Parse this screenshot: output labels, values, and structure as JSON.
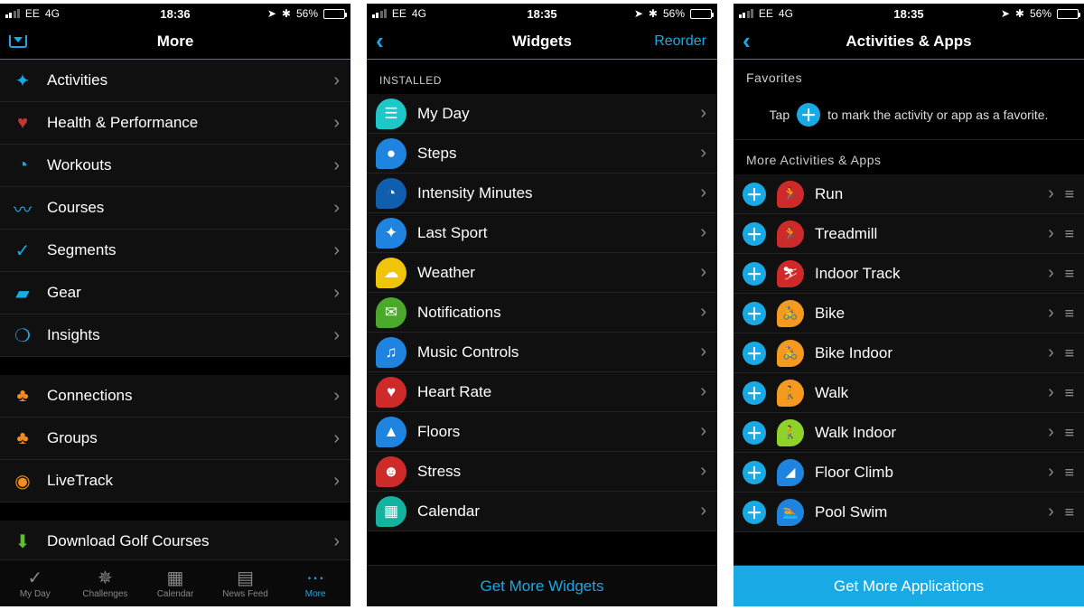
{
  "status": {
    "carrier": "EE",
    "net": "4G",
    "time_a": "18:36",
    "time_b": "18:35",
    "battery_pct": "56%",
    "nav_icon": "➤",
    "bt_icon": "✱"
  },
  "more": {
    "title": "More",
    "items_a": [
      {
        "icon": "✦",
        "color": "blue",
        "label": "Activities"
      },
      {
        "icon": "♥",
        "color": "red",
        "label": "Health & Performance"
      },
      {
        "icon": "◔",
        "color": "blue",
        "label": "Workouts"
      },
      {
        "icon": "〰",
        "color": "blue",
        "label": "Courses"
      },
      {
        "icon": "✓",
        "color": "blue",
        "label": "Segments"
      },
      {
        "icon": "▰",
        "color": "blue",
        "label": "Gear"
      },
      {
        "icon": "❍",
        "color": "blue",
        "label": "Insights"
      }
    ],
    "items_b": [
      {
        "icon": "♣",
        "color": "orange",
        "label": "Connections"
      },
      {
        "icon": "♣",
        "color": "orange",
        "label": "Groups"
      },
      {
        "icon": "◉",
        "color": "orange",
        "label": "LiveTrack"
      }
    ],
    "items_c": [
      {
        "icon": "⬇",
        "color": "green",
        "label": "Download Golf Courses"
      }
    ],
    "tabs": [
      {
        "icon": "✓",
        "label": "My Day"
      },
      {
        "icon": "✵",
        "label": "Challenges"
      },
      {
        "icon": "▦",
        "label": "Calendar"
      },
      {
        "icon": "▤",
        "label": "News Feed"
      },
      {
        "icon": "⋯",
        "label": "More",
        "active": true
      }
    ]
  },
  "widgets": {
    "title": "Widgets",
    "reorder": "Reorder",
    "section": "INSTALLED",
    "items": [
      {
        "bg": "teal",
        "icon": "☰",
        "label": "My Day"
      },
      {
        "bg": "bgblue",
        "icon": "●",
        "label": "Steps"
      },
      {
        "bg": "bgdblue",
        "icon": "◔",
        "label": "Intensity Minutes"
      },
      {
        "bg": "bgblue",
        "icon": "✦",
        "label": "Last Sport"
      },
      {
        "bg": "bgyellow",
        "icon": "☁",
        "label": "Weather"
      },
      {
        "bg": "bggreen",
        "icon": "✉",
        "label": "Notifications"
      },
      {
        "bg": "bgblue",
        "icon": "♫",
        "label": "Music Controls"
      },
      {
        "bg": "bgred",
        "icon": "♥",
        "label": "Heart Rate"
      },
      {
        "bg": "bgblue",
        "icon": "▲",
        "label": "Floors"
      },
      {
        "bg": "bgred",
        "icon": "☻",
        "label": "Stress"
      },
      {
        "bg": "bgteal2",
        "icon": "▦",
        "label": "Calendar"
      }
    ],
    "cta": "Get More Widgets"
  },
  "activities": {
    "title": "Activities & Apps",
    "fav_section": "Favorites",
    "fav_hint_pre": "Tap",
    "fav_hint_post": "to mark the activity or app as a favorite.",
    "more_section": "More Activities & Apps",
    "items": [
      {
        "bg": "bgred",
        "icon": "🏃",
        "label": "Run"
      },
      {
        "bg": "bgred",
        "icon": "🏃",
        "label": "Treadmill"
      },
      {
        "bg": "bgred",
        "icon": "⛷",
        "label": "Indoor Track"
      },
      {
        "bg": "bgorange",
        "icon": "🚴",
        "label": "Bike"
      },
      {
        "bg": "bgorange",
        "icon": "🚴",
        "label": "Bike Indoor"
      },
      {
        "bg": "bgorange",
        "icon": "🚶",
        "label": "Walk"
      },
      {
        "bg": "bgl-green",
        "icon": "🚶",
        "label": "Walk Indoor"
      },
      {
        "bg": "bgblue",
        "icon": "◢",
        "label": "Floor Climb"
      },
      {
        "bg": "bgblue",
        "icon": "🏊",
        "label": "Pool Swim"
      }
    ],
    "cta": "Get More Applications"
  }
}
